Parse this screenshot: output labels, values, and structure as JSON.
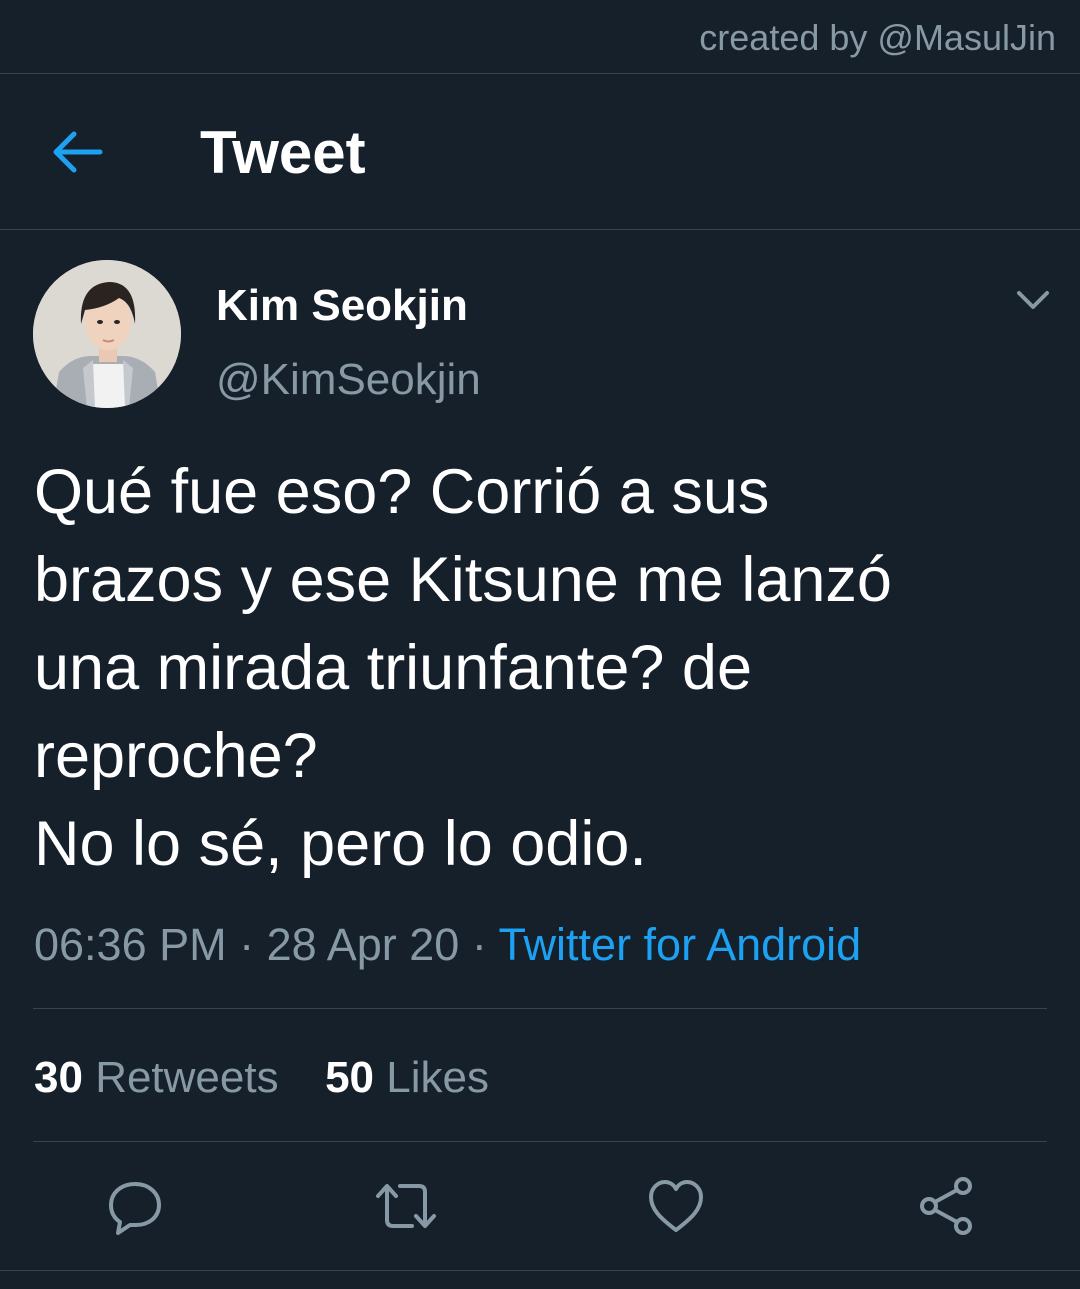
{
  "credit": "created by @MasulJin",
  "header": {
    "title": "Tweet",
    "back_icon": "arrow-left-icon"
  },
  "author": {
    "display_name": "Kim Seokjin",
    "handle": "@KimSeokjin",
    "menu_icon": "chevron-down-icon"
  },
  "tweet": {
    "lines": [
      "Qué fue eso? Corrió a sus",
      "brazos y ese Kitsune me lanzó",
      "una mirada triunfante? de",
      "reproche?",
      "No lo sé, pero lo odio."
    ],
    "time": "06:36 PM",
    "date": "28 Apr 20",
    "separator": "·",
    "source": "Twitter for Android"
  },
  "stats": {
    "retweets_count": "30",
    "retweets_label": "Retweets",
    "likes_count": "50",
    "likes_label": "Likes"
  },
  "actions": [
    "reply-icon",
    "retweet-icon",
    "like-icon",
    "share-icon"
  ],
  "colors": {
    "background": "#15202b",
    "accent": "#1da1f2",
    "muted": "#8899a6",
    "divider": "#38444d"
  }
}
